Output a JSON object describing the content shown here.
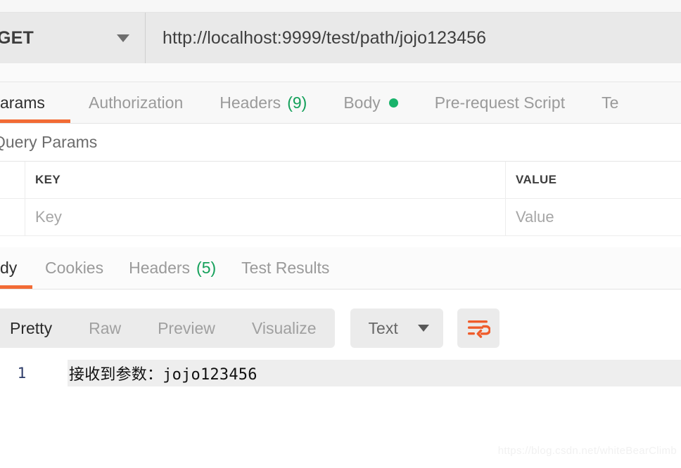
{
  "request": {
    "method": "GET",
    "method_caret_icon": "chevron-down-icon",
    "url": "http://localhost:9999/test/path/jojo123456",
    "tabs": [
      {
        "label": "arams",
        "count": "",
        "dot": false,
        "active": true
      },
      {
        "label": "Authorization",
        "count": "",
        "dot": false,
        "active": false
      },
      {
        "label": "Headers",
        "count": "(9)",
        "dot": false,
        "active": false
      },
      {
        "label": "Body",
        "count": "",
        "dot": true,
        "active": false
      },
      {
        "label": "Pre-request Script",
        "count": "",
        "dot": false,
        "active": false
      },
      {
        "label": "Te",
        "count": "",
        "dot": false,
        "active": false
      }
    ],
    "query_params": {
      "title": "Query Params",
      "columns": [
        "KEY",
        "VALUE"
      ],
      "rows": [
        {
          "key_placeholder": "Key",
          "value_placeholder": "Value"
        }
      ]
    }
  },
  "response": {
    "tabs": [
      {
        "label": "dy",
        "count": "",
        "active": true
      },
      {
        "label": "Cookies",
        "count": "",
        "active": false
      },
      {
        "label": "Headers",
        "count": "(5)",
        "active": false
      },
      {
        "label": "Test Results",
        "count": "",
        "active": false
      }
    ],
    "formats": [
      {
        "label": "Pretty",
        "active": true
      },
      {
        "label": "Raw",
        "active": false
      },
      {
        "label": "Preview",
        "active": false
      },
      {
        "label": "Visualize",
        "active": false
      }
    ],
    "content_type": "Text",
    "content_type_caret_icon": "chevron-down-icon",
    "wrap_icon": "word-wrap-icon",
    "body": {
      "lines": [
        {
          "number": "1",
          "text": "接收到参数：jojo123456"
        }
      ]
    }
  },
  "watermark": "https://blog.csdn.net/whiteBearClimb",
  "colors": {
    "accent_orange": "#f26b35",
    "green": "#14a05a",
    "body_dot_green": "#19b36b"
  }
}
